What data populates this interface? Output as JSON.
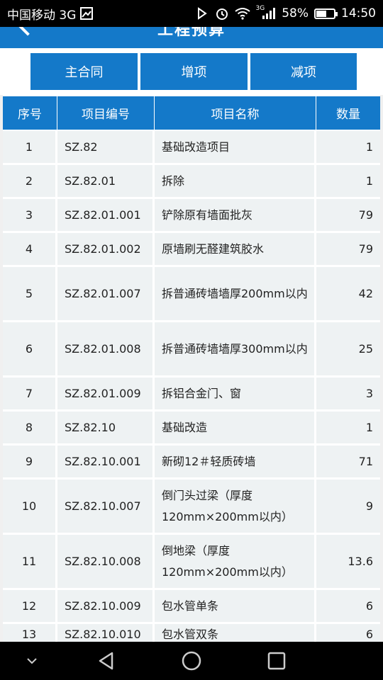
{
  "status_bar": {
    "carrier": "中国移动 3G",
    "network_type": "3G",
    "battery": "58%",
    "time": "14:50",
    "icons": [
      "image-icon",
      "nfc-icon",
      "alarm-icon",
      "wifi-icon",
      "signal-icon",
      "battery-icon"
    ]
  },
  "header": {
    "title": "工程预算"
  },
  "tabs": [
    {
      "label": "主合同"
    },
    {
      "label": "增项"
    },
    {
      "label": "减项"
    }
  ],
  "table": {
    "columns": [
      "序号",
      "项目编号",
      "项目名称",
      "数量"
    ],
    "rows": [
      {
        "no": "1",
        "code": "SZ.82",
        "name": "基础改造项目",
        "qty": "1"
      },
      {
        "no": "2",
        "code": "SZ.82.01",
        "name": "拆除",
        "qty": "1"
      },
      {
        "no": "3",
        "code": "SZ.82.01.001",
        "name": "铲除原有墙面批灰",
        "qty": "79"
      },
      {
        "no": "4",
        "code": "SZ.82.01.002",
        "name": "原墙刷无醛建筑胶水",
        "qty": "79"
      },
      {
        "no": "5",
        "code": "SZ.82.01.007",
        "name": "拆普通砖墙墙厚200mm以内",
        "qty": "42"
      },
      {
        "no": "6",
        "code": "SZ.82.01.008",
        "name": "拆普通砖墙墙厚300mm以内",
        "qty": "25"
      },
      {
        "no": "7",
        "code": "SZ.82.01.009",
        "name": "拆铝合金门、窗",
        "qty": "3"
      },
      {
        "no": "8",
        "code": "SZ.82.10",
        "name": "基础改造",
        "qty": "1"
      },
      {
        "no": "9",
        "code": "SZ.82.10.001",
        "name": "新砌12＃轻质砖墙",
        "qty": "71"
      },
      {
        "no": "10",
        "code": "SZ.82.10.007",
        "name": "倒门头过梁（厚度120mm×200mm以内）",
        "qty": "9"
      },
      {
        "no": "11",
        "code": "SZ.82.10.008",
        "name": "倒地梁（厚度120mm×200mm以内）",
        "qty": "13.6"
      },
      {
        "no": "12",
        "code": "SZ.82.10.009",
        "name": "包水管单条",
        "qty": "6"
      },
      {
        "no": "13",
        "code": "SZ.82.10.010",
        "name": "包水管双条",
        "qty": "6"
      }
    ]
  },
  "nav": {
    "buttons": [
      "chevron-down-icon",
      "back-triangle-icon",
      "home-circle-icon",
      "recent-square-icon"
    ]
  }
}
